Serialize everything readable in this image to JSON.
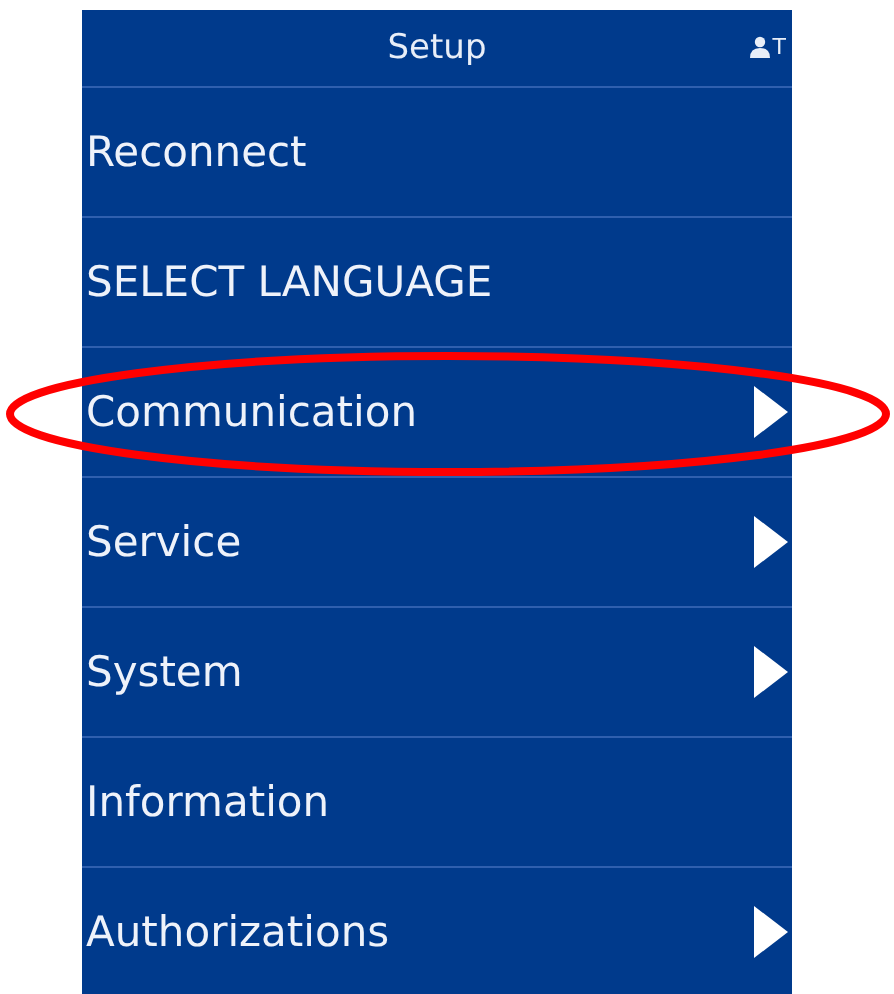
{
  "header": {
    "title": "Setup",
    "user_badge": "T"
  },
  "items": [
    {
      "label": "Reconnect",
      "has_submenu": false,
      "circled": false
    },
    {
      "label": "SELECT LANGUAGE",
      "has_submenu": false,
      "circled": false
    },
    {
      "label": "Communication",
      "has_submenu": true,
      "circled": true
    },
    {
      "label": "Service",
      "has_submenu": true,
      "circled": false
    },
    {
      "label": "System",
      "has_submenu": true,
      "circled": false
    },
    {
      "label": "Information",
      "has_submenu": false,
      "circled": false
    },
    {
      "label": "Authorizations",
      "has_submenu": true,
      "circled": false
    }
  ]
}
